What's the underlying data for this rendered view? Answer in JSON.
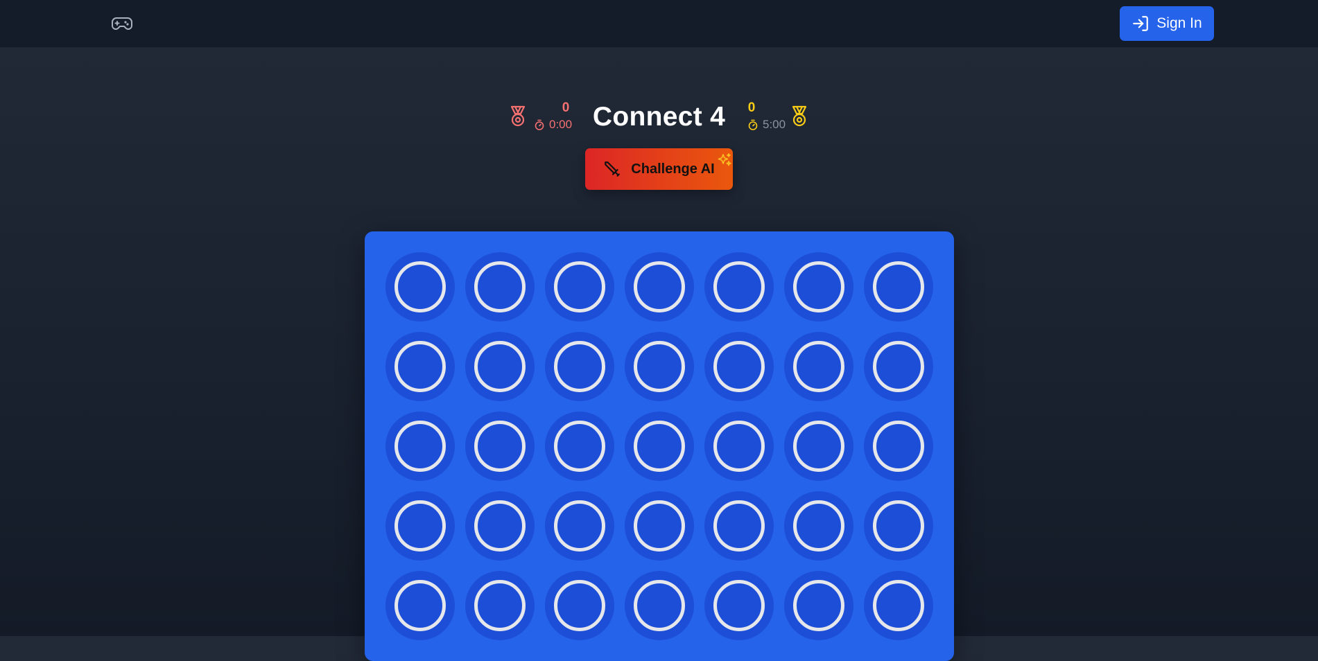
{
  "nav": {
    "logo_icon": "gamepad-icon",
    "signin_label": "Sign In",
    "signin_icon": "login-arrow-icon"
  },
  "game": {
    "title": "Connect 4",
    "player_red": {
      "score": "0",
      "timer": "0:00",
      "color": "#f87171",
      "icon": "medal-icon"
    },
    "player_yellow": {
      "score": "0",
      "timer": "5:00",
      "color": "#facc15",
      "icon": "medal-icon"
    },
    "challenge_label": "Challenge AI",
    "challenge_icon": "sword-icon",
    "sparkle_icon": "sparkles-icon"
  },
  "board": {
    "color": "#2563eb",
    "columns": 7,
    "visible_rows": 5,
    "cells": [
      [
        "empty",
        "empty",
        "empty",
        "empty",
        "empty",
        "empty",
        "empty"
      ],
      [
        "empty",
        "empty",
        "empty",
        "empty",
        "empty",
        "empty",
        "empty"
      ],
      [
        "empty",
        "empty",
        "empty",
        "empty",
        "empty",
        "empty",
        "empty"
      ],
      [
        "empty",
        "empty",
        "empty",
        "empty",
        "empty",
        "empty",
        "empty"
      ],
      [
        "empty",
        "empty",
        "empty",
        "empty",
        "empty",
        "empty",
        "empty"
      ]
    ]
  }
}
